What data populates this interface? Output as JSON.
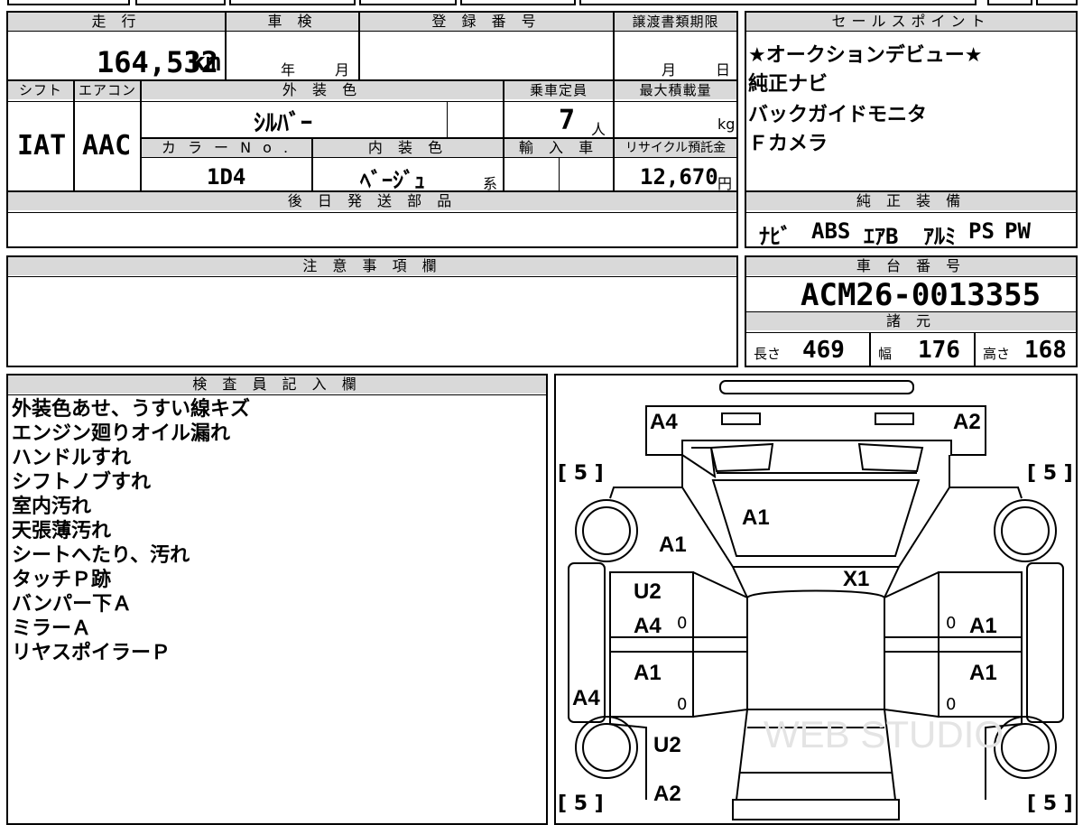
{
  "vehicle_info": {
    "mileage_label": "走 行",
    "inspection_label": "車 検",
    "registration_label": "登 録 番 号",
    "transfer_deadline_label": "譲渡書類期限",
    "mileage_value": "164,532",
    "mileage_unit": "km",
    "inspection_year": "年",
    "inspection_month": "月",
    "deadline_month": "月",
    "deadline_day": "日",
    "shift_label": "シフト",
    "ac_label": "エアコン",
    "exterior_color_label": "外 装 色",
    "capacity_label": "乗車定員",
    "max_load_label": "最大積載量",
    "shift_value": "IAT",
    "ac_value": "AAC",
    "exterior_color_value": "ｼﾙﾊﾞｰ",
    "capacity_value": "7",
    "capacity_unit": "人",
    "max_load_unit": "kg",
    "color_no_label": "カ ラ ー N o .",
    "interior_color_label": "内 装 色",
    "import_label": "輸 入 車",
    "recycle_label": "リサイクル預託金",
    "color_no_value": "1D4",
    "interior_color_value": "ﾍﾞｰｼﾞｭ",
    "interior_color_suffix": "系",
    "recycle_value": "12,670",
    "recycle_unit": "円",
    "later_shipping_label": "後 日 発 送 部 品"
  },
  "sales_points": {
    "label": "セールスポイント",
    "items": [
      "★オークションデビュー★",
      "純正ナビ",
      "バックガイドモニタ",
      "Ｆカメラ"
    ]
  },
  "factory_equipment": {
    "label": "純 正 装 備",
    "items": [
      "ﾅﾋﾞ",
      "ABS",
      "ｴｱB",
      "ｱﾙﾐ",
      "PS",
      "PW"
    ]
  },
  "notes": {
    "label": "注 意 事 項 欄"
  },
  "chassis": {
    "label": "車 台 番 号",
    "value": "ACM26-0013355"
  },
  "specs": {
    "label": "諸 元",
    "length_label": "長さ",
    "length_value": "469",
    "width_label": "幅",
    "width_value": "176",
    "height_label": "高さ",
    "height_value": "168"
  },
  "inspector": {
    "label": "検 査 員 記 入 欄",
    "lines": [
      "外装色あせ、うすい線キズ",
      "エンジン廻りオイル漏れ",
      "ハンドルすれ",
      "シフトノブすれ",
      "室内汚れ",
      "天張薄汚れ",
      "シートへたり、汚れ",
      "タッチＰ跡",
      "バンパー下Ａ",
      "ミラーＡ",
      "リヤスポイラーＰ"
    ]
  },
  "diagram": {
    "tire_label": "[ 5 ]",
    "marks": {
      "front_left": "A4",
      "front_right": "A2",
      "hood_left": "A1",
      "windshield": "A1",
      "roof": "X1",
      "left_front_door_1": "U2",
      "left_front_door_2": "A4",
      "left_rear_door": "A1",
      "left_side": "A4",
      "right_front_door": "A1",
      "right_rear_door": "A1",
      "rear_left": "U2",
      "rear": "A2"
    },
    "zero_mark": "0",
    "watermark": "WEB STUDIO"
  }
}
